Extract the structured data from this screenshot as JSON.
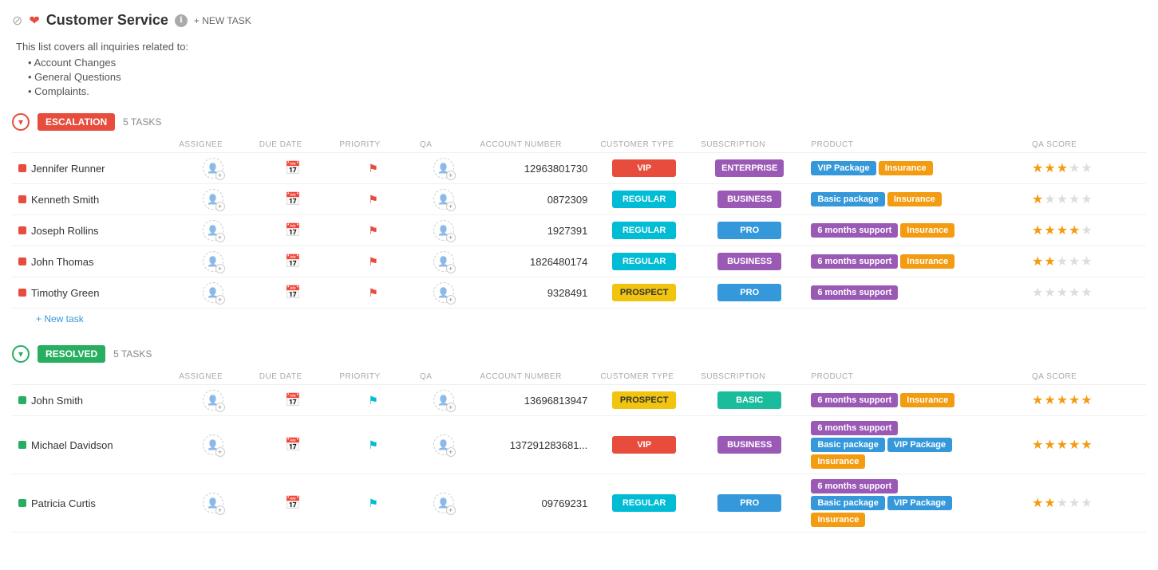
{
  "page": {
    "title": "Customer Service",
    "info_icon": "ℹ",
    "new_task_label": "+ NEW TASK"
  },
  "description": {
    "intro": "This list covers all inquiries related to:",
    "items": [
      "Account Changes",
      "General Questions",
      "Complaints."
    ]
  },
  "escalation_section": {
    "badge_label": "ESCALATION",
    "task_count": "5 TASKS",
    "columns": [
      "ASSIGNEE",
      "DUE DATE",
      "PRIORITY",
      "QA",
      "ACCOUNT NUMBER",
      "CUSTOMER TYPE",
      "SUBSCRIPTION",
      "PRODUCT",
      "QA SCORE"
    ],
    "tasks": [
      {
        "name": "Jennifer Runner",
        "account": "12963801730",
        "customer_type": "VIP",
        "subscription": "ENTERPRISE",
        "products": [
          {
            "label": "VIP Package",
            "type": "vip"
          },
          {
            "label": "Insurance",
            "type": "insurance"
          }
        ],
        "stars": [
          1,
          1,
          1,
          0,
          0
        ]
      },
      {
        "name": "Kenneth Smith",
        "account": "0872309",
        "customer_type": "REGULAR",
        "subscription": "BUSINESS",
        "products": [
          {
            "label": "Basic package",
            "type": "basic"
          },
          {
            "label": "Insurance",
            "type": "insurance"
          }
        ],
        "stars": [
          1,
          0,
          0,
          0,
          0
        ]
      },
      {
        "name": "Joseph Rollins",
        "account": "1927391",
        "customer_type": "REGULAR",
        "subscription": "PRO",
        "products": [
          {
            "label": "6 months support",
            "type": "support"
          },
          {
            "label": "Insurance",
            "type": "insurance"
          }
        ],
        "stars": [
          1,
          1,
          1,
          1,
          0
        ]
      },
      {
        "name": "John Thomas",
        "account": "1826480174",
        "customer_type": "REGULAR",
        "subscription": "BUSINESS",
        "products": [
          {
            "label": "6 months support",
            "type": "support"
          },
          {
            "label": "Insurance",
            "type": "insurance"
          }
        ],
        "stars": [
          1,
          1,
          0,
          0,
          0
        ]
      },
      {
        "name": "Timothy Green",
        "account": "9328491",
        "customer_type": "PROSPECT",
        "subscription": "PRO",
        "products": [
          {
            "label": "6 months support",
            "type": "support"
          }
        ],
        "stars": [
          0,
          0,
          0,
          0,
          0
        ]
      }
    ],
    "new_task_label": "+ New task"
  },
  "resolved_section": {
    "badge_label": "RESOLVED",
    "task_count": "5 TASKS",
    "columns": [
      "ASSIGNEE",
      "DUE DATE",
      "PRIORITY",
      "QA",
      "ACCOUNT NUMBER",
      "CUSTOMER TYPE",
      "SUBSCRIPTION",
      "PRODUCT",
      "QA SCORE"
    ],
    "tasks": [
      {
        "name": "John Smith",
        "account": "13696813947",
        "customer_type": "PROSPECT",
        "subscription": "BASIC",
        "products": [
          {
            "label": "6 months support",
            "type": "support"
          },
          {
            "label": "Insurance",
            "type": "insurance"
          }
        ],
        "stars": [
          1,
          1,
          1,
          1,
          1
        ]
      },
      {
        "name": "Michael Davidson",
        "account": "137291283681...",
        "customer_type": "VIP",
        "subscription": "BUSINESS",
        "products": [
          {
            "label": "6 months support",
            "type": "support"
          },
          {
            "label": "Basic package",
            "type": "basic"
          },
          {
            "label": "VIP Package",
            "type": "vip"
          },
          {
            "label": "Insurance",
            "type": "insurance"
          }
        ],
        "stars": [
          1,
          1,
          1,
          1,
          1
        ]
      },
      {
        "name": "Patricia Curtis",
        "account": "09769231",
        "customer_type": "REGULAR",
        "subscription": "PRO",
        "products": [
          {
            "label": "6 months support",
            "type": "support"
          },
          {
            "label": "Basic package",
            "type": "basic"
          },
          {
            "label": "VIP Package",
            "type": "vip"
          },
          {
            "label": "Insurance",
            "type": "insurance"
          }
        ],
        "stars": [
          1,
          1,
          0,
          0,
          0
        ]
      }
    ]
  }
}
